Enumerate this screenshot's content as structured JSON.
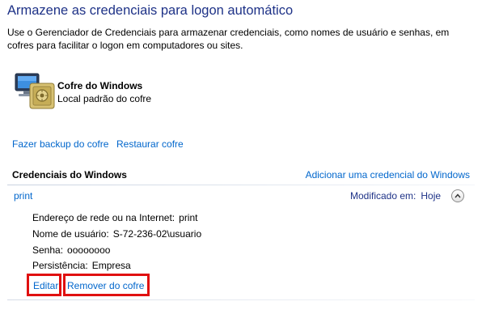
{
  "header": {
    "title": "Armazene as credenciais para logon automático",
    "description": "Use o Gerenciador de Credenciais para armazenar credenciais, como nomes de usuário e senhas, em cofres para facilitar o logon em computadores ou sites."
  },
  "vault": {
    "name": "Cofre do Windows",
    "subtitle": "Local padrão do cofre",
    "icon": "vault-icon"
  },
  "vault_actions": {
    "backup": "Fazer backup do cofre",
    "restore": "Restaurar cofre"
  },
  "windows_credentials": {
    "title": "Credenciais do Windows",
    "add_link": "Adicionar uma credencial do Windows",
    "entries": [
      {
        "name": "print",
        "modified_label": "Modificado em:",
        "modified_value": "Hoje",
        "fields": [
          {
            "label": "Endereço de rede ou na Internet:",
            "value": "print"
          },
          {
            "label": "Nome de usuário:",
            "value": "S-72-236-02\\usuario"
          },
          {
            "label": "Senha:",
            "value": "oooooooo"
          },
          {
            "label": "Persistência:",
            "value": "Empresa"
          }
        ],
        "edit_label": "Editar",
        "remove_label": "Remover do cofre"
      }
    ]
  },
  "colors": {
    "title": "#1e3287",
    "link": "#0066cc",
    "highlight": "#e01010"
  }
}
